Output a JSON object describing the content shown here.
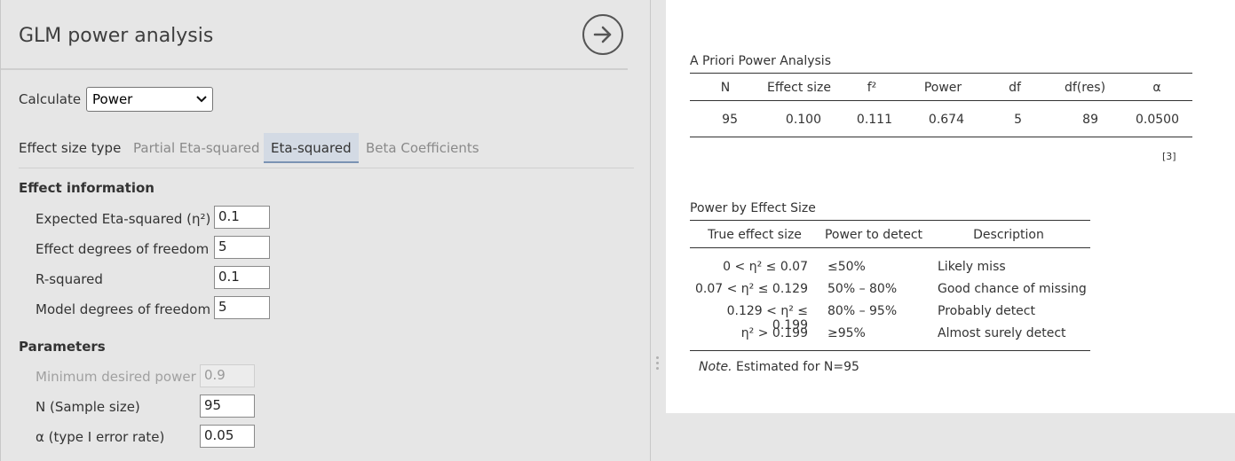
{
  "options": {
    "title": "GLM power analysis",
    "calculate_label": "Calculate",
    "calculate_value": "Power",
    "effect_size_type_label": "Effect size type",
    "tabs": [
      {
        "label": "Partial Eta-squared",
        "active": false
      },
      {
        "label": "Eta-squared",
        "active": true
      },
      {
        "label": "Beta Coefficients",
        "active": false
      }
    ],
    "effect_info": {
      "heading": "Effect information",
      "fields": [
        {
          "label": "Expected Eta-squared (η²)",
          "value": "0.1"
        },
        {
          "label": "Effect degrees of freedom",
          "value": "5"
        },
        {
          "label": "R-squared",
          "value": "0.1"
        },
        {
          "label": "Model degrees of freedom",
          "value": "5"
        }
      ]
    },
    "parameters": {
      "heading": "Parameters",
      "fields": [
        {
          "label": "Minimum desired power",
          "value": "0.9",
          "disabled": true
        },
        {
          "label": "N (Sample size)",
          "value": "95",
          "disabled": false
        },
        {
          "label": "α (type I error rate)",
          "value": "0.05",
          "disabled": false
        }
      ]
    }
  },
  "results": {
    "apriori": {
      "title": "A Priori Power Analysis",
      "columns": [
        "N",
        "Effect size",
        "f²",
        "Power",
        "df",
        "df(res)",
        "α"
      ],
      "row": [
        "95",
        "0.100",
        "0.111",
        "0.674",
        "5",
        "89",
        "0.0500"
      ],
      "ref": "[3]"
    },
    "by_effect": {
      "title": "Power by Effect Size",
      "columns": [
        "True effect size",
        "Power to detect",
        "Description"
      ],
      "rows": [
        [
          "0 < η² ≤ 0.07",
          "≤50%",
          "Likely miss"
        ],
        [
          "0.07 < η² ≤ 0.129",
          "50% – 80%",
          "Good chance of missing"
        ],
        [
          "0.129 < η² ≤ 0.199",
          "80% – 95%",
          "Probably detect"
        ],
        [
          "η² > 0.199",
          "≥95%",
          "Almost surely detect"
        ]
      ],
      "note_prefix": "Note.",
      "note_text": " Estimated for N=95"
    }
  }
}
